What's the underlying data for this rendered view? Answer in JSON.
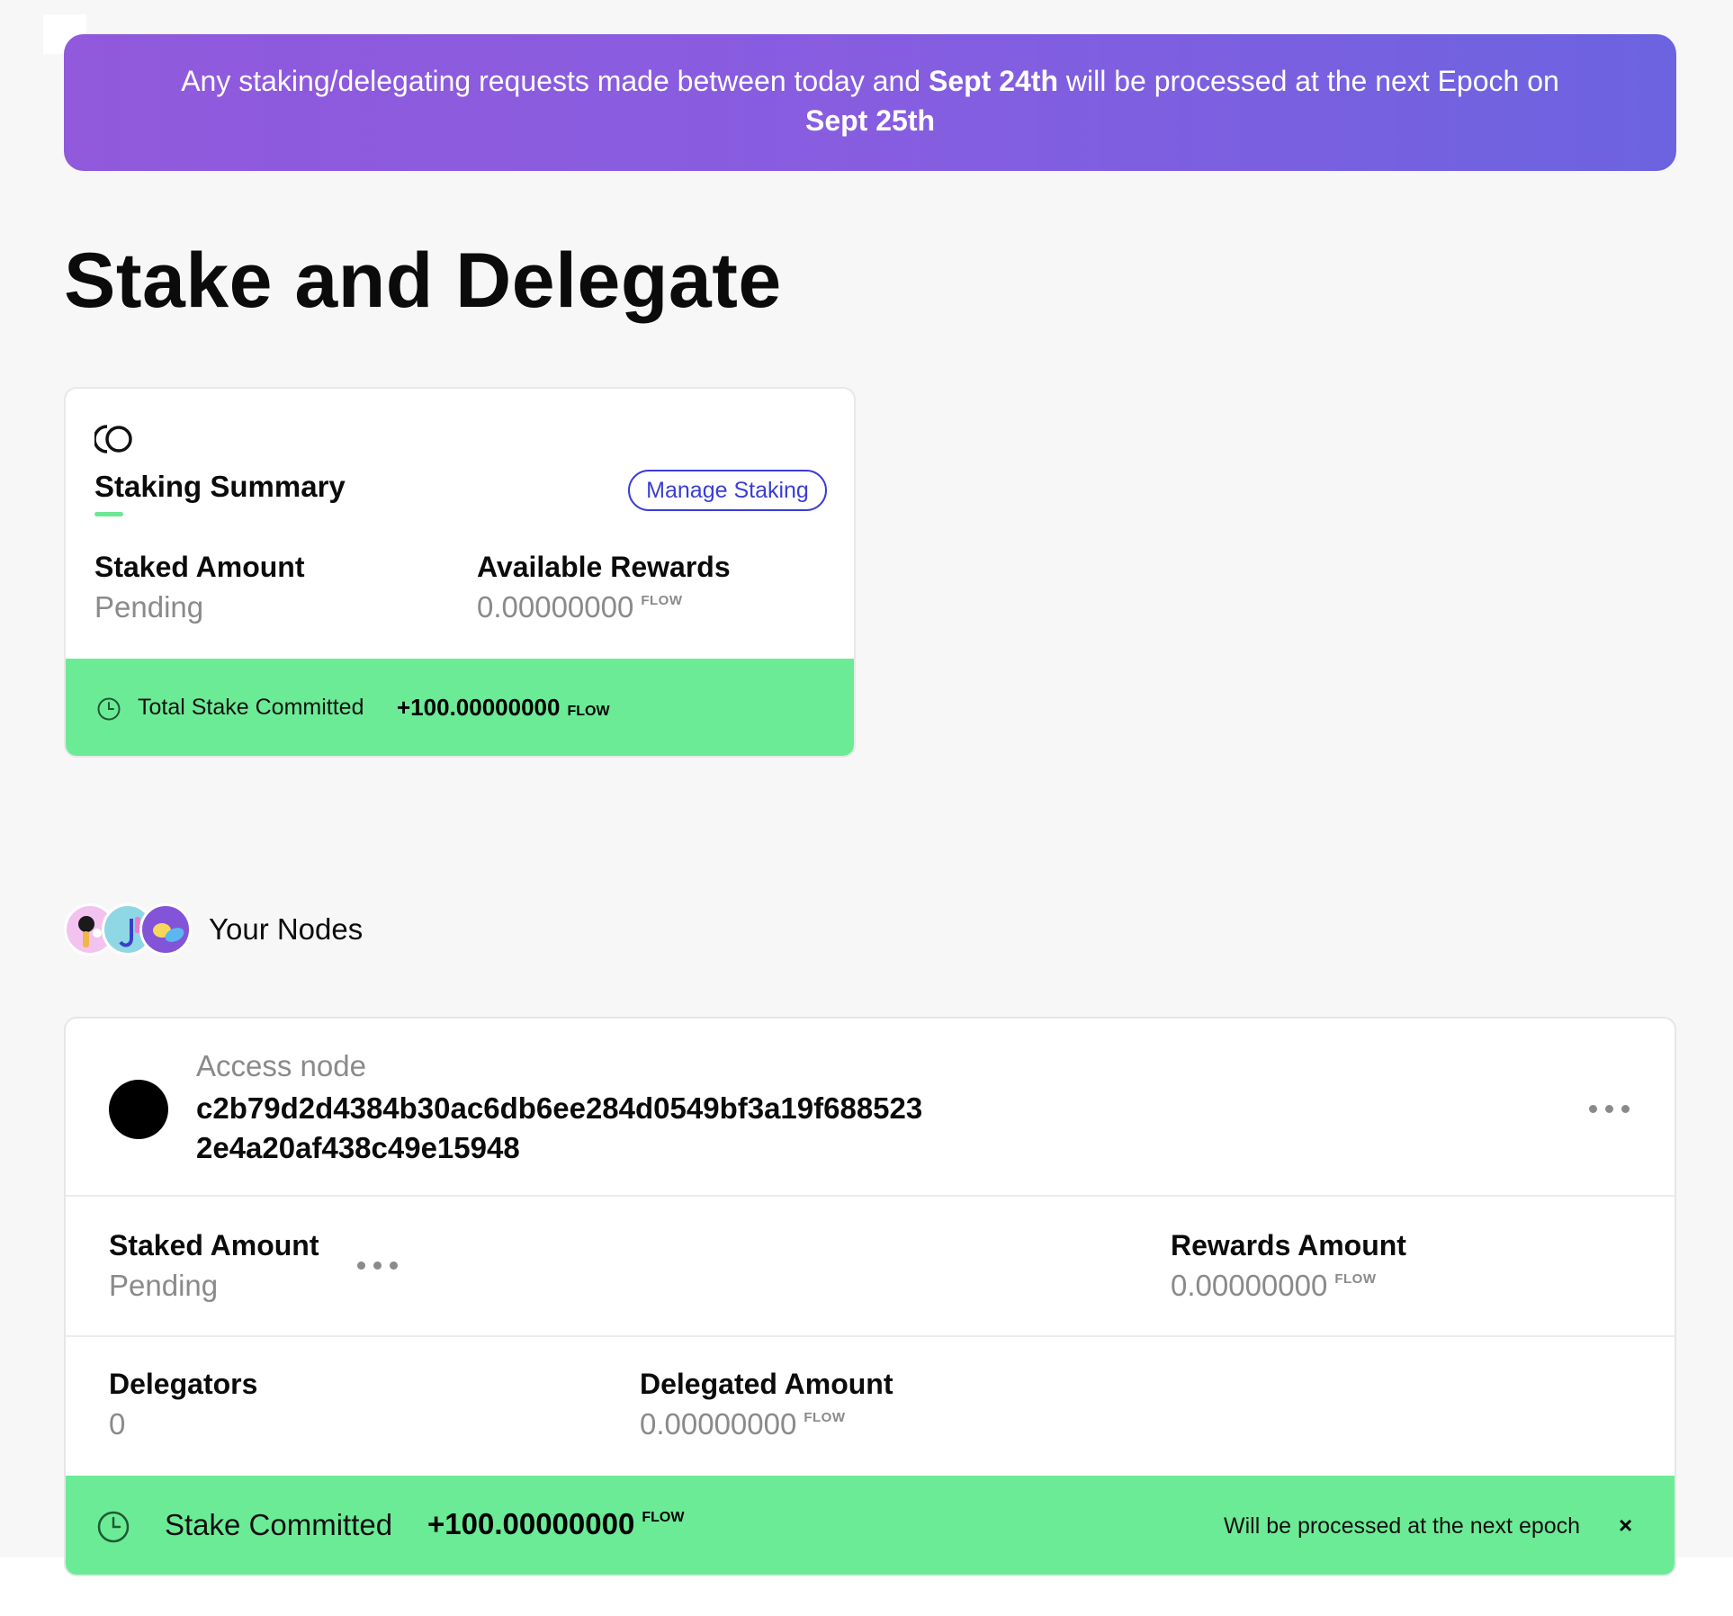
{
  "banner": {
    "text_1": "Any staking/delegating requests made between today and ",
    "date_1": "Sept 24th",
    "text_2": " will be processed at the next Epoch on ",
    "date_2": "Sept 25th"
  },
  "page_title": "Stake and Delegate",
  "summary": {
    "title": "Staking Summary",
    "manage_button": "Manage Staking",
    "staked_label": "Staked Amount",
    "staked_value": "Pending",
    "rewards_label": "Available Rewards",
    "rewards_value": "0.00000000",
    "rewards_unit": "FLOW",
    "footer_label": "Total Stake Committed",
    "footer_amount": "+100.00000000",
    "footer_unit": "FLOW"
  },
  "nodes_section": {
    "title": "Your Nodes"
  },
  "node": {
    "type": "Access node",
    "id": "c2b79d2d4384b30ac6db6ee284d0549bf3a19f6885232e4a20af438c49e15948",
    "staked_label": "Staked Amount",
    "staked_value": "Pending",
    "rewards_label": "Rewards Amount",
    "rewards_value": "0.00000000",
    "rewards_unit": "FLOW",
    "delegators_label": "Delegators",
    "delegators_value": "0",
    "delegated_label": "Delegated Amount",
    "delegated_value": "0.00000000",
    "delegated_unit": "FLOW",
    "footer_label": "Stake Committed",
    "footer_amount": "+100.00000000",
    "footer_unit": "FLOW",
    "footer_note": "Will be processed at the next epoch",
    "close_label": "×"
  },
  "colors": {
    "banner_start": "#9159dc",
    "banner_end": "#6c63e0",
    "success_green": "#6ceb96",
    "accent_blue": "#3a3dd6"
  }
}
